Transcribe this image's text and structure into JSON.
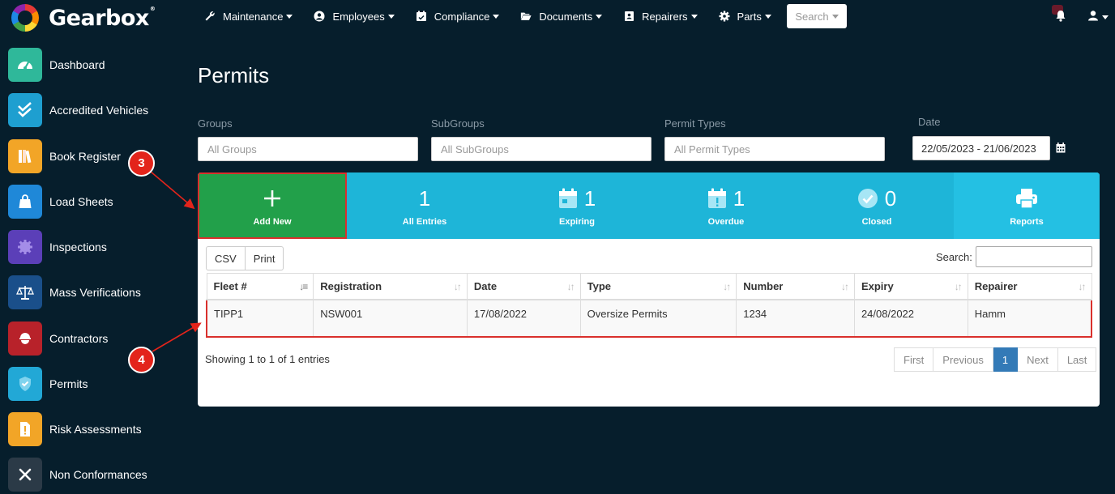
{
  "app": {
    "name": "Gearbox",
    "reg": "®"
  },
  "topnav": [
    {
      "label": "Maintenance",
      "icon": "wrench-icon"
    },
    {
      "label": "Employees",
      "icon": "user-circle-icon"
    },
    {
      "label": "Compliance",
      "icon": "calendar-check-icon"
    },
    {
      "label": "Documents",
      "icon": "folder-open-icon"
    },
    {
      "label": "Repairers",
      "icon": "address-book-icon"
    },
    {
      "label": "Parts",
      "icon": "gear-icon"
    }
  ],
  "search": {
    "label": "Search"
  },
  "sidebar": {
    "items": [
      {
        "label": "Dashboard",
        "icon": "speedometer-icon",
        "color": "#2fb89a"
      },
      {
        "label": "Accredited Vehicles",
        "icon": "double-check-icon",
        "color": "#1e9fd0"
      },
      {
        "label": "Book Register",
        "icon": "books-icon",
        "color": "#f2a527"
      },
      {
        "label": "Load Sheets",
        "icon": "bag-icon",
        "color": "#1f88d8"
      },
      {
        "label": "Inspections",
        "icon": "badge-icon",
        "color": "#5b3fb8"
      },
      {
        "label": "Mass Verifications",
        "icon": "scales-icon",
        "color": "#1a4f8a"
      },
      {
        "label": "Contractors",
        "icon": "hardhat-icon",
        "color": "#b8222a"
      },
      {
        "label": "Permits",
        "icon": "shield-check-icon",
        "color": "#22a8d6"
      },
      {
        "label": "Risk Assessments",
        "icon": "file-alert-icon",
        "color": "#f2a527"
      },
      {
        "label": "Non Conformances",
        "icon": "close-icon",
        "color": "#2b3a47"
      }
    ]
  },
  "page": {
    "title": "Permits"
  },
  "filters": {
    "groups": {
      "label": "Groups",
      "placeholder": "All Groups"
    },
    "subgroups": {
      "label": "SubGroups",
      "placeholder": "All SubGroups"
    },
    "permit_types": {
      "label": "Permit Types",
      "placeholder": "All Permit Types"
    },
    "date": {
      "label": "Date",
      "value": "22/05/2023 - 21/06/2023"
    }
  },
  "stats": {
    "add_new": "Add New",
    "all_entries": {
      "count": "1",
      "label": "All Entries"
    },
    "expiring": {
      "count": "1",
      "label": "Expiring"
    },
    "overdue": {
      "count": "1",
      "label": "Overdue"
    },
    "closed": {
      "count": "0",
      "label": "Closed"
    },
    "reports": "Reports"
  },
  "toolbar": {
    "csv": "CSV",
    "print": "Print",
    "search_label": "Search:"
  },
  "table": {
    "headers": [
      "Fleet #",
      "Registration",
      "Date",
      "Type",
      "Number",
      "Expiry",
      "Repairer"
    ],
    "rows": [
      [
        "TIPP1",
        "NSW001",
        "17/08/2022",
        "Oversize Permits",
        "1234",
        "24/08/2022",
        "Hamm"
      ]
    ]
  },
  "footer": {
    "showing": "Showing 1 to 1 of 1 entries"
  },
  "pagination": {
    "first": "First",
    "previous": "Previous",
    "current": "1",
    "next": "Next",
    "last": "Last"
  },
  "callouts": {
    "step3": "3",
    "step4": "4"
  }
}
